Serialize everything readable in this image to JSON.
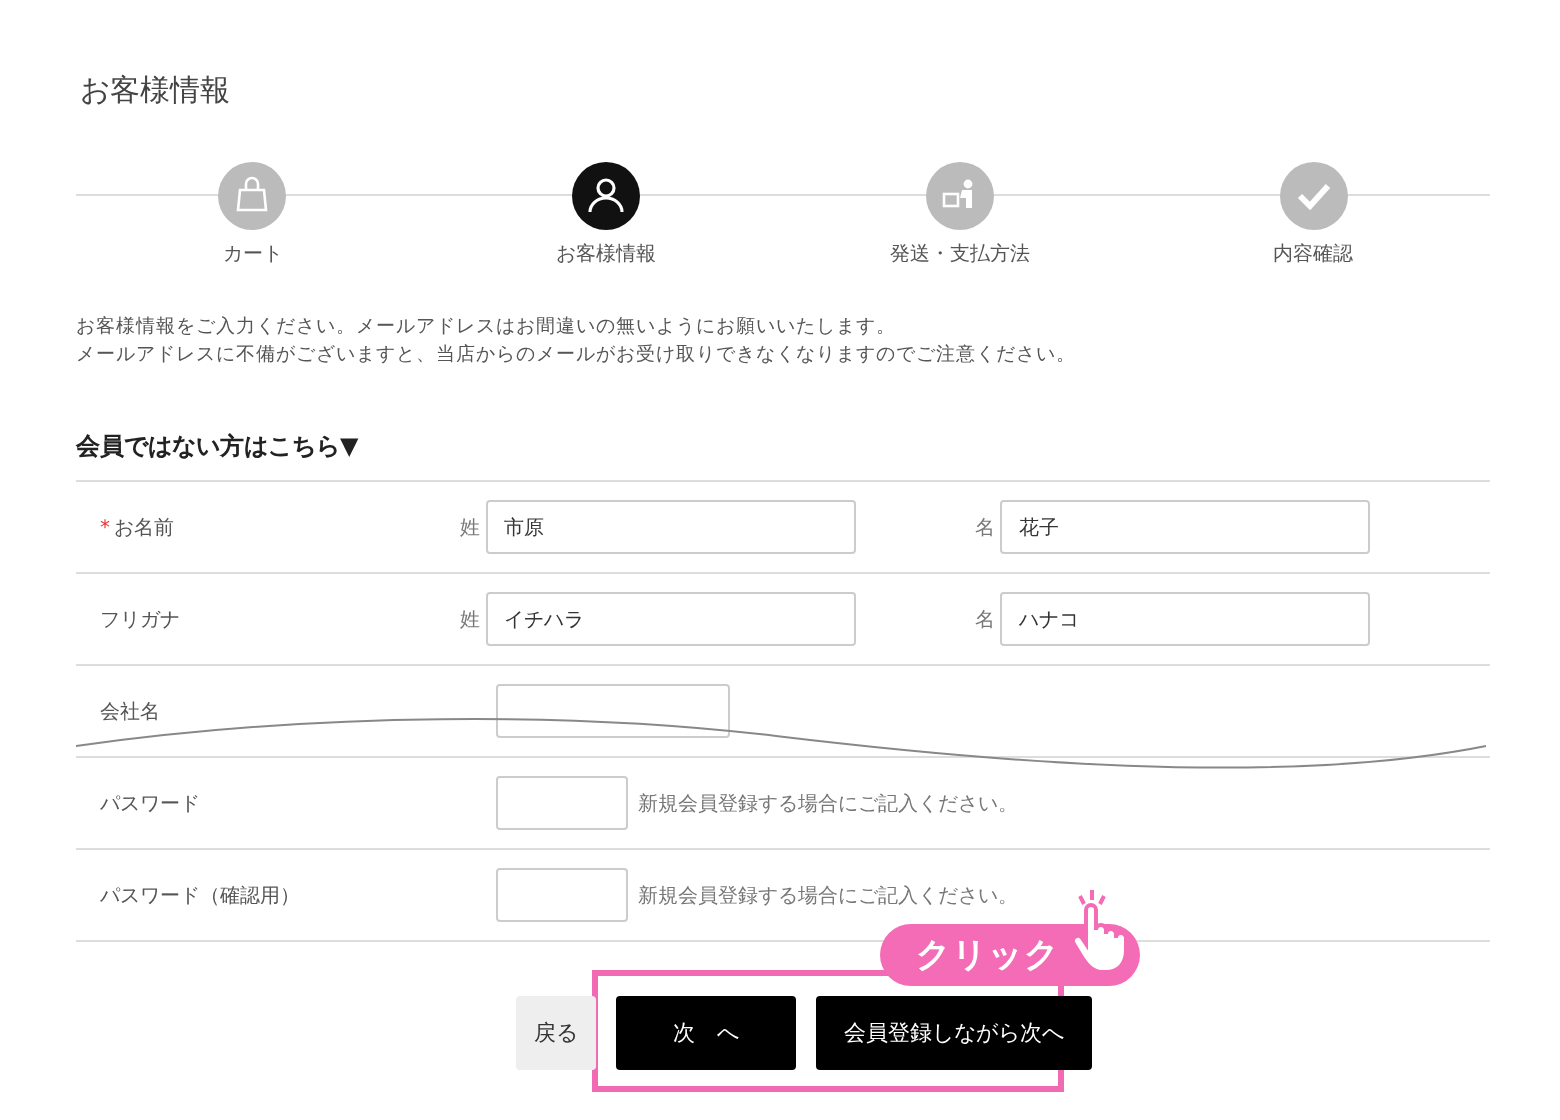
{
  "title": "お客様情報",
  "steps": [
    {
      "label": "カート",
      "selected": false
    },
    {
      "label": "お客様情報",
      "selected": true
    },
    {
      "label": "発送・支払方法",
      "selected": false
    },
    {
      "label": "内容確認",
      "selected": false
    }
  ],
  "intro": [
    "お客様情報をご入力ください。メールアドレスはお間違いの無いようにお願いいたします。",
    "メールアドレスに不備がございますと、当店からのメールがお受け取りできなくなりますのでご注意ください。"
  ],
  "section_heading": "会員ではない方はこちら▼",
  "rows": [
    {
      "kind": "pair",
      "label": "お名前",
      "required": true,
      "required_mark": "*",
      "fields": [
        {
          "prefix": "姓",
          "value": "市原"
        },
        {
          "prefix": "名",
          "value": "花子"
        }
      ]
    },
    {
      "kind": "pair",
      "label": "フリガナ",
      "required": false,
      "fields": [
        {
          "prefix": "姓",
          "value": "イチハラ"
        },
        {
          "prefix": "名",
          "value": "ハナコ"
        }
      ]
    },
    {
      "kind": "single",
      "label": "会社名",
      "required": false
    },
    {
      "kind": "hint",
      "label": "パスワード",
      "required": false,
      "hint": "新規会員登録する場合にご記入ください。"
    },
    {
      "kind": "hint",
      "label": "パスワード（確認用）",
      "required": false,
      "hint": "新規会員登録する場合にご記入ください。"
    }
  ],
  "buttons": [
    {
      "label": "戻る",
      "kind": "secondary"
    },
    {
      "label": "次　へ",
      "kind": "primary"
    },
    {
      "label": "会員登録しながら次へ",
      "kind": "primary"
    }
  ],
  "callout": "クリック"
}
